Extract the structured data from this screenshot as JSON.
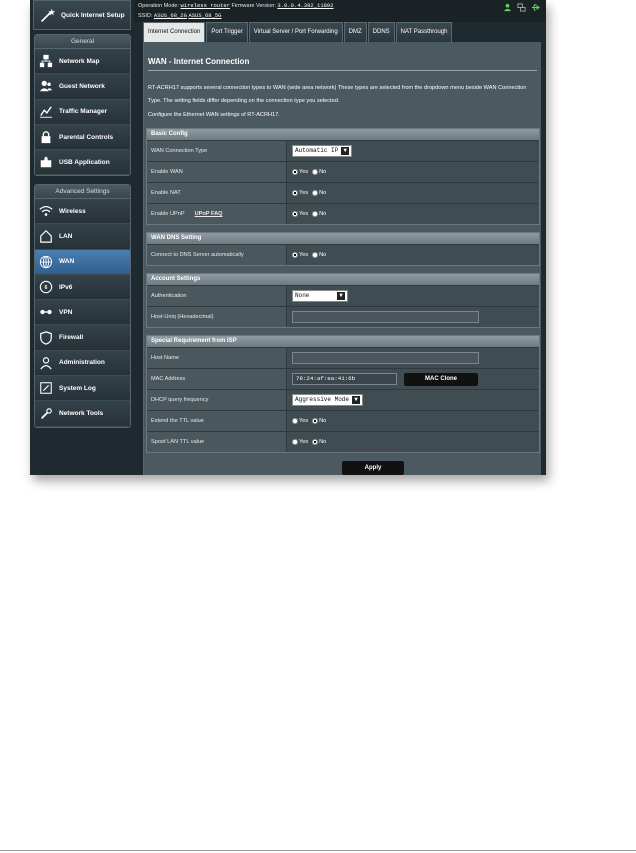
{
  "header": {
    "op_mode_label": "Operation Mode:",
    "op_mode_value": "wireless router",
    "firmware_label": "Firmware Version:",
    "firmware_value": "3.0.0.4.382_11802",
    "ssid_label": "SSID:",
    "ssid_2g": "ASUS_68_2G",
    "ssid_5g": "ASUS_68_5G"
  },
  "sidebar": {
    "quick_setup": "Quick Internet Setup",
    "general_title": "General",
    "general_items": [
      {
        "label": "Network Map",
        "icon": "network-map-icon"
      },
      {
        "label": "Guest Network",
        "icon": "guest-network-icon"
      },
      {
        "label": "Traffic Manager",
        "icon": "traffic-manager-icon"
      },
      {
        "label": "Parental Controls",
        "icon": "lock-icon"
      },
      {
        "label": "USB Application",
        "icon": "puzzle-icon"
      }
    ],
    "advanced_title": "Advanced Settings",
    "advanced_items": [
      {
        "label": "Wireless",
        "icon": "wifi-icon"
      },
      {
        "label": "LAN",
        "icon": "home-icon"
      },
      {
        "label": "WAN",
        "icon": "globe-icon"
      },
      {
        "label": "IPv6",
        "icon": "ipv6-icon"
      },
      {
        "label": "VPN",
        "icon": "vpn-icon"
      },
      {
        "label": "Firewall",
        "icon": "shield-icon"
      },
      {
        "label": "Administration",
        "icon": "admin-icon"
      },
      {
        "label": "System Log",
        "icon": "system-log-icon"
      },
      {
        "label": "Network Tools",
        "icon": "tools-icon"
      }
    ]
  },
  "tabs": [
    "Internet Connection",
    "Port Trigger",
    "Virtual Server / Port Forwarding",
    "DMZ",
    "DDNS",
    "NAT Passthrough"
  ],
  "main": {
    "title": "WAN - Internet Connection",
    "description": "RT-ACRH17 supports several connection types to WAN (wide area network) These types are selected from the dropdown menu beside WAN Connection Type. The setting fields differ depending on the connection type you selected.",
    "configure": "Configure the Ethernet WAN settings of RT-ACRH17.",
    "yes": "Yes",
    "no": "No",
    "basic": {
      "title": "Basic Config",
      "wan_type_label": "WAN Connection Type",
      "wan_type_value": "Automatic IP",
      "enable_wan": "Enable WAN",
      "enable_nat": "Enable NAT",
      "enable_upnp": "Enable UPnP",
      "upnp_faq": "UPnP FAQ"
    },
    "dns": {
      "title": "WAN DNS Setting",
      "auto_label": "Connect to DNS Server automatically"
    },
    "account": {
      "title": "Account Settings",
      "auth_label": "Authentication",
      "auth_value": "None",
      "host_uniq_label": "Host-Uniq (Hexadecimal)"
    },
    "isp": {
      "title": "Special Requirement from ISP",
      "host_name_label": "Host Name",
      "mac_label": "MAC Address",
      "mac_value": "78:24:af:ea:41:6b",
      "mac_clone": "MAC Clone",
      "dhcp_label": "DHCP query frequency",
      "dhcp_value": "Aggressive Mode",
      "extend_ttl": "Extend the TTL value",
      "spoof_ttl": "Spoof LAN TTL value"
    },
    "apply": "Apply"
  }
}
